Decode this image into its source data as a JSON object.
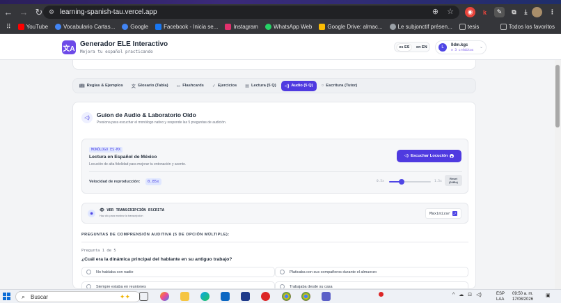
{
  "browser": {
    "url": "learning-spanish-tau.vercel.app",
    "bookmarks": [
      {
        "label": "YouTube",
        "color": "#ff0000"
      },
      {
        "label": "Vocabulario Cartas...",
        "color": "#4285f4"
      },
      {
        "label": "Google",
        "color": "#4285f4"
      },
      {
        "label": "Facebook - Inicia se...",
        "color": "#1877f2"
      },
      {
        "label": "Instagram",
        "color": "#e1306c"
      },
      {
        "label": "WhatsApp Web",
        "color": "#25d366"
      },
      {
        "label": "Google Drive: almac...",
        "color": "#fbbc04"
      },
      {
        "label": "Le subjonctif présen...",
        "color": "#9aa0a6"
      },
      {
        "label": "tesis",
        "color": "#9aa0a6"
      }
    ],
    "all_bookmarks": "Todos los favoritos"
  },
  "header": {
    "logo_glyph": "文A",
    "title": "Generador ELE Interactivo",
    "subtitle": "Mejora tu español practicando",
    "lang_es": "es ES",
    "lang_en": "en EN",
    "user_initial": "L",
    "user_name": "lldm.kgc",
    "user_credits": "⊙ 3 créditos"
  },
  "tabs": [
    {
      "label": "Reglas & Ejemplos",
      "icon": "book-icon"
    },
    {
      "label": "Glosario (Tabla)",
      "icon": "translate-icon"
    },
    {
      "label": "Flashcards",
      "icon": "cards-icon"
    },
    {
      "label": "Ejercicios",
      "icon": "check-circle-icon"
    },
    {
      "label": "Lectura (5 Q)",
      "icon": "document-icon"
    },
    {
      "label": "Audio (5 Q)",
      "icon": "speaker-icon",
      "active": true
    },
    {
      "label": "Escritura (Tutor)",
      "icon": "circle-icon"
    }
  ],
  "audio": {
    "title": "Guion de Audio & Laboratorio Oído",
    "description": "Presiona para escuchar el monólogo nativo y responde las 5 preguntas de audición.",
    "badge": "MONÓLOGO ES-MX",
    "voice_title": "Lectura en Español de México",
    "voice_desc": "Locución de alta fidelidad para mejorar tu entonación y acento.",
    "play_label": "Escuchar Locución",
    "speed_label": "Velocidad de reproducción:",
    "speed_value": "0.85x",
    "speed_fraction": 0.3,
    "speed_min": "0.5x",
    "speed_max": "1.5x",
    "reset_label": "Reset",
    "reset_value": "(0.85x)",
    "transcript_title": "VER TRANSCRIPCIÓN ESCRITA",
    "transcript_sub": "Haz clic para mostrar la transcripción",
    "maximize_label": "Maximizar"
  },
  "questions": {
    "section_title": "PREGUNTAS DE COMPRENSIÓN AUDITIVA (5 DE OPCIÓN MÚLTIPLE):",
    "counter": "Pregunta 1 de 5",
    "question": "¿Cuál era la dinámica principal del hablante en su antiguo trabajo?",
    "options": [
      "No hablaba con nadie",
      "Platicaba con sus compañeros durante el almuerzo",
      "Siempre estaba en reuniones",
      "Trabajaba desde su casa"
    ]
  },
  "taskbar": {
    "search_placeholder": "Buscar",
    "lang_top": "ESP",
    "lang_bottom": "LAA",
    "time": "09:50 a. m.",
    "date": "17/08/2026"
  },
  "colors": {
    "accent": "#4f3ae0",
    "brand": "#6d4ae8"
  }
}
